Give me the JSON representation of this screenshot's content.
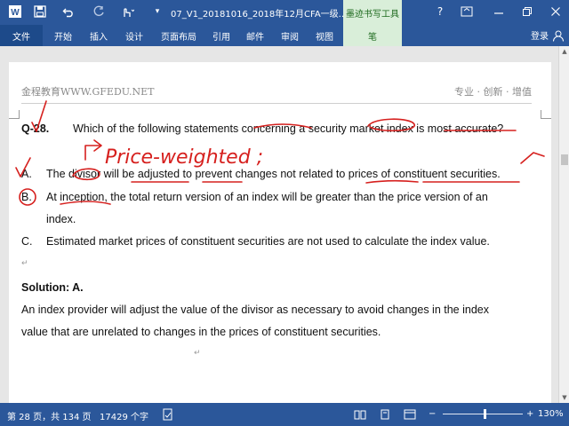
{
  "titlebar": {
    "doc_title": "07_V1_20181016_2018年12月CFA一级...",
    "context_tab": "墨迹书写工具",
    "help": "?",
    "word_icon": "W"
  },
  "ribbon": {
    "tabs": [
      "文件",
      "开始",
      "插入",
      "设计",
      "页面布局",
      "引用",
      "邮件",
      "审阅",
      "视图",
      "笔"
    ],
    "login": "登录"
  },
  "header": {
    "left": "金程教育WWW.GFEDU.NET",
    "right": "专业 · 创新 · 增值"
  },
  "question": {
    "number": "Q-28.",
    "stem": "Which of the following statements concerning a security market index is most accurate?",
    "options": [
      {
        "letter": "A.",
        "text": "The divisor will be adjusted to prevent changes not related to prices of constituent securities."
      },
      {
        "letter": "B.",
        "text": "At inception, the total return version of an index will be greater than the price version of an"
      },
      {
        "letter": "",
        "text": "index."
      },
      {
        "letter": "C.",
        "text": "Estimated market prices of constituent securities are not used to calculate the index value."
      }
    ]
  },
  "solution": {
    "heading": "Solution: A.",
    "line1": "An index provider will adjust the value of the divisor as necessary to avoid changes in the index",
    "line2": "value that are unrelated to changes in the prices of constituent securities."
  },
  "annotation": {
    "handwriting": "Price-weighted ;"
  },
  "statusbar": {
    "page_info": "第 28 页，共 134 页",
    "word_count": "17429 个字",
    "zoom": "130%"
  },
  "icons": {
    "save": "save-icon",
    "undo": "undo-icon",
    "redo": "redo-icon",
    "touch": "touch-mode-icon",
    "customize": "customize-qat-icon"
  },
  "colors": {
    "accent": "#2b579a",
    "ink": "#d6201e",
    "context": "#d9eed9"
  }
}
